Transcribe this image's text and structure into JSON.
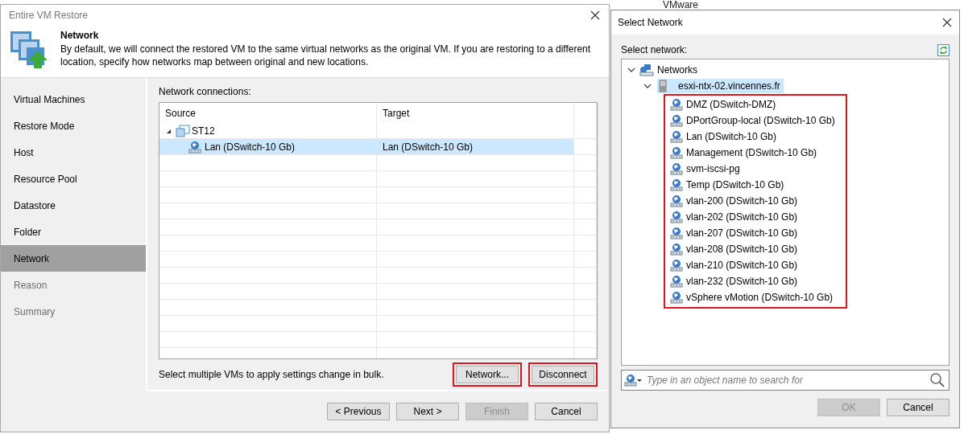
{
  "background_text": "VMware",
  "restore_wizard": {
    "title": "Entire VM Restore",
    "header": {
      "title": "Network",
      "description": "By default, we will connect the restored VM to the same virtual networks as the original VM. If you are restoring to a different location, specify how networks map between original and new locations."
    },
    "steps": [
      {
        "label": "Virtual Machines",
        "selected": false,
        "disabled": false
      },
      {
        "label": "Restore Mode",
        "selected": false,
        "disabled": false
      },
      {
        "label": "Host",
        "selected": false,
        "disabled": false
      },
      {
        "label": "Resource Pool",
        "selected": false,
        "disabled": false
      },
      {
        "label": "Datastore",
        "selected": false,
        "disabled": false
      },
      {
        "label": "Folder",
        "selected": false,
        "disabled": false
      },
      {
        "label": "Network",
        "selected": true,
        "disabled": false
      },
      {
        "label": "Reason",
        "selected": false,
        "disabled": true
      },
      {
        "label": "Summary",
        "selected": false,
        "disabled": true
      }
    ],
    "section_label": "Network connections:",
    "table": {
      "columns": [
        "Source",
        "Target"
      ],
      "rows": [
        {
          "kind": "vm",
          "source": "ST12",
          "expanded": true,
          "selected": false
        },
        {
          "kind": "network",
          "source": "Lan (DSwitch-10 Gb)",
          "target": "Lan (DSwitch-10 Gb)",
          "selected": true
        }
      ]
    },
    "hint": "Select multiple VMs to apply settings change in bulk.",
    "actions": [
      {
        "label": "Network...",
        "highlighted": true
      },
      {
        "label": "Disconnect",
        "highlighted": true
      }
    ],
    "footer_buttons": [
      {
        "label": "< Previous",
        "disabled": false
      },
      {
        "label": "Next >",
        "disabled": false
      },
      {
        "label": "Finish",
        "disabled": true
      },
      {
        "label": "Cancel",
        "disabled": false
      }
    ]
  },
  "select_network": {
    "title": "Select Network",
    "label": "Select network:",
    "tree": {
      "label": "Networks",
      "expanded": true,
      "children": [
        {
          "label": "esxi-ntx-02.vincennes.fr",
          "expanded": true,
          "selected": true,
          "children_highlighted": true,
          "children": [
            {
              "label": "DMZ (DSwitch-DMZ)"
            },
            {
              "label": "DPortGroup-local (DSwitch-10 Gb)"
            },
            {
              "label": "Lan (DSwitch-10 Gb)"
            },
            {
              "label": "Management (DSwitch-10 Gb)"
            },
            {
              "label": "svm-iscsi-pg"
            },
            {
              "label": "Temp (DSwitch-10 Gb)"
            },
            {
              "label": "vlan-200 (DSwitch-10 Gb)"
            },
            {
              "label": "vlan-202 (DSwitch-10 Gb)"
            },
            {
              "label": "vlan-207 (DSwitch-10 Gb)"
            },
            {
              "label": "vlan-208 (DSwitch-10 Gb)"
            },
            {
              "label": "vlan-210 (DSwitch-10 Gb)"
            },
            {
              "label": "vlan-232 (DSwitch-10 Gb)"
            },
            {
              "label": "vSphere vMotion (DSwitch-10 Gb)"
            }
          ]
        }
      ]
    },
    "search": {
      "placeholder": "Type in an object name to search for"
    },
    "buttons": [
      {
        "label": "OK",
        "disabled": true
      },
      {
        "label": "Cancel",
        "disabled": false
      }
    ]
  }
}
